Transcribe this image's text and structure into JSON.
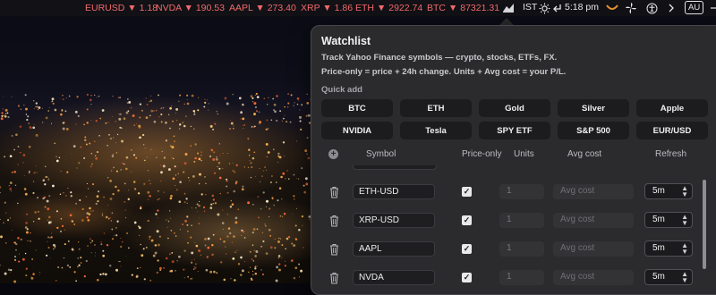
{
  "menubar": {
    "tickers": [
      {
        "symbol": "EURUSD",
        "arrow": "▼",
        "price": "1.18"
      },
      {
        "symbol": "NVDA",
        "arrow": "▼",
        "price": "190.53"
      },
      {
        "symbol": "AAPL",
        "arrow": "▼",
        "price": "273.40"
      },
      {
        "symbol": "XRP",
        "arrow": "▼",
        "price": "1.86"
      },
      {
        "symbol": "ETH",
        "arrow": "▼",
        "price": "2922.74"
      },
      {
        "symbol": "BTC",
        "arrow": "▼",
        "price": "87321.31"
      }
    ],
    "ticker_color": "#f26a6a",
    "timezone": "IST",
    "time": "5:18 pm",
    "input_source": "AU",
    "icons": [
      "stocks-tray-icon",
      "weather-sun-icon",
      "return-arrow-icon",
      "app-icon-orange",
      "pinwheel-icon",
      "accessibility-icon",
      "chevron-right-icon"
    ]
  },
  "panel": {
    "title": "Watchlist",
    "subtitle": "Track Yahoo Finance symbols — crypto, stocks, ETFs, FX.",
    "hint": "Price-only = price + 24h change. Units + Avg cost = your P/L.",
    "quick_add_label": "Quick add",
    "quick_add": [
      [
        "BTC",
        "ETH",
        "Gold",
        "Silver",
        "Apple"
      ],
      [
        "NVIDIA",
        "Tesla",
        "SPY ETF",
        "S&P 500",
        "EUR/USD"
      ]
    ],
    "columns": {
      "symbol": "Symbol",
      "price_only": "Price-only",
      "units": "Units",
      "avg_cost": "Avg cost",
      "refresh": "Refresh"
    },
    "rows": [
      {
        "symbol": "ETH-USD",
        "price_only": true,
        "units_placeholder": "1",
        "avg_placeholder": "Avg cost",
        "refresh": "5m"
      },
      {
        "symbol": "XRP-USD",
        "price_only": true,
        "units_placeholder": "1",
        "avg_placeholder": "Avg cost",
        "refresh": "5m"
      },
      {
        "symbol": "AAPL",
        "price_only": true,
        "units_placeholder": "1",
        "avg_placeholder": "Avg cost",
        "refresh": "5m"
      },
      {
        "symbol": "NVDA",
        "price_only": true,
        "units_placeholder": "1",
        "avg_placeholder": "Avg cost",
        "refresh": "5m"
      }
    ]
  }
}
